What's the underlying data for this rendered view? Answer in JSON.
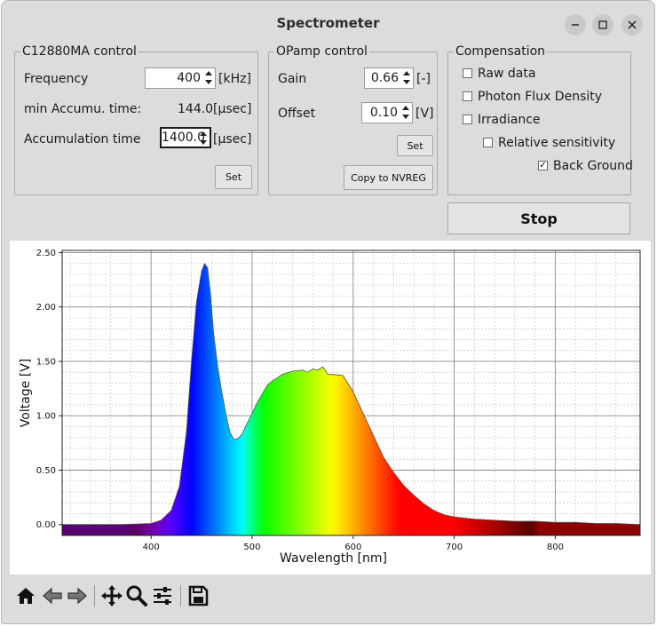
{
  "window": {
    "title": "Spectrometer"
  },
  "c12880": {
    "title": "C12880MA control",
    "frequency_label": "Frequency",
    "frequency_value": "400",
    "frequency_unit": "[kHz]",
    "min_accum_label": "min Accumu. time:",
    "min_accum_value": "144.0",
    "min_accum_unit": "[μsec]",
    "accum_label": "Accumulation time",
    "accum_value": "1400.0",
    "accum_unit": "[μsec]",
    "set_label": "Set"
  },
  "opamp": {
    "title": "OPamp control",
    "gain_label": "Gain",
    "gain_value": "0.66",
    "gain_unit": "[-]",
    "offset_label": "Offset",
    "offset_value": "0.10",
    "offset_unit": "[V]",
    "set_label": "Set",
    "copy_label": "Copy to NVREG"
  },
  "compensation": {
    "title": "Compensation",
    "items": [
      {
        "label": "Raw data",
        "checked": false
      },
      {
        "label": "Photon Flux Density",
        "checked": false
      },
      {
        "label": "Irradiance",
        "checked": false
      },
      {
        "label": "Relative sensitivity",
        "checked": false
      },
      {
        "label": "Back Ground",
        "checked": true
      }
    ]
  },
  "stop_label": "Stop",
  "toolbar": {
    "icons": [
      "home-icon",
      "back-icon",
      "forward-icon",
      "pan-icon",
      "zoom-icon",
      "configure-icon",
      "save-icon"
    ]
  },
  "chart_data": {
    "type": "area",
    "title": "",
    "xlabel": "Wavelength [nm]",
    "ylabel": "Voltage [V]",
    "xlim": [
      312,
      884
    ],
    "ylim": [
      -0.1,
      2.52
    ],
    "xticks": [
      400,
      500,
      600,
      700,
      800
    ],
    "xtick_labels": [
      "400",
      "500",
      "600",
      "700",
      "800"
    ],
    "yticks": [
      0.0,
      0.5,
      1.0,
      1.5,
      2.0,
      2.5
    ],
    "ytick_labels": [
      "0.00",
      "0.50",
      "1.00",
      "1.50",
      "2.00",
      "2.50"
    ],
    "grid": true,
    "fill": "wavelength-color gradient",
    "x": [
      312,
      340,
      370,
      400,
      410,
      420,
      428,
      435,
      440,
      445,
      450,
      453,
      456,
      459,
      462,
      466,
      470,
      474,
      478,
      482,
      486,
      490,
      495,
      500,
      505,
      510,
      515,
      520,
      530,
      540,
      550,
      555,
      560,
      565,
      570,
      575,
      580,
      590,
      600,
      610,
      620,
      630,
      640,
      650,
      660,
      670,
      680,
      690,
      700,
      720,
      740,
      760,
      780,
      800,
      820,
      840,
      860,
      884
    ],
    "y": [
      0.0,
      0.0,
      0.0,
      0.01,
      0.04,
      0.13,
      0.35,
      0.85,
      1.5,
      2.05,
      2.33,
      2.4,
      2.36,
      2.1,
      1.75,
      1.45,
      1.22,
      1.02,
      0.85,
      0.78,
      0.79,
      0.83,
      0.93,
      1.02,
      1.12,
      1.2,
      1.28,
      1.32,
      1.38,
      1.41,
      1.42,
      1.4,
      1.43,
      1.42,
      1.45,
      1.38,
      1.38,
      1.37,
      1.22,
      1.02,
      0.82,
      0.62,
      0.48,
      0.36,
      0.27,
      0.19,
      0.13,
      0.09,
      0.07,
      0.05,
      0.04,
      0.03,
      0.03,
      0.02,
      0.02,
      0.01,
      0.01,
      0.0
    ]
  }
}
